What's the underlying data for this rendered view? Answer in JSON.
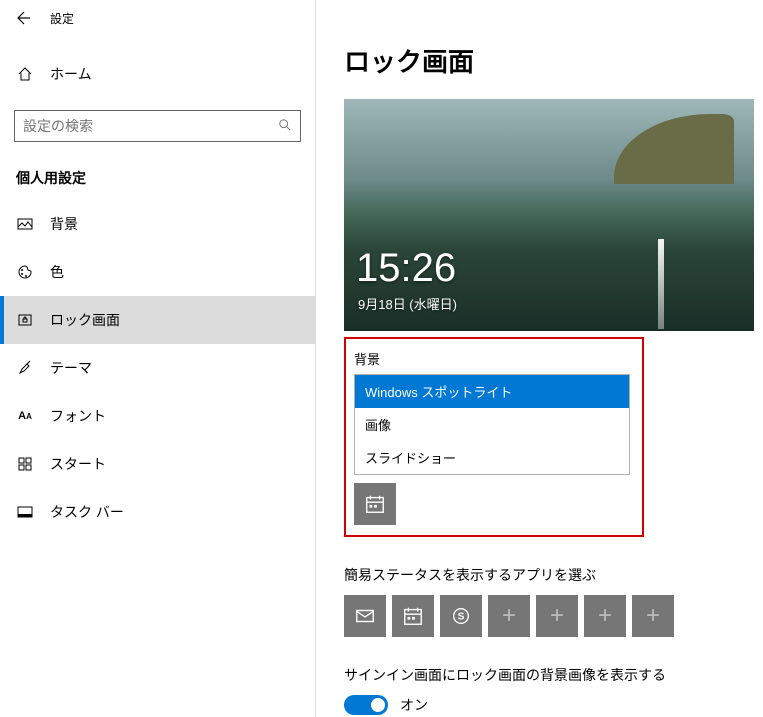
{
  "header": {
    "window_title": "設定"
  },
  "sidebar": {
    "home_label": "ホーム",
    "search_placeholder": "設定の検索",
    "section_heading": "個人用設定",
    "items": [
      {
        "label": "背景",
        "icon": "picture-icon"
      },
      {
        "label": "色",
        "icon": "palette-icon"
      },
      {
        "label": "ロック画面",
        "icon": "lock-frame-icon",
        "selected": true
      },
      {
        "label": "テーマ",
        "icon": "paintbrush-icon"
      },
      {
        "label": "フォント",
        "icon": "font-icon"
      },
      {
        "label": "スタート",
        "icon": "start-grid-icon"
      },
      {
        "label": "タスク バー",
        "icon": "taskbar-icon"
      }
    ]
  },
  "main": {
    "page_title": "ロック画面",
    "preview": {
      "time": "15:26",
      "date": "9月18日 (水曜日)"
    },
    "background": {
      "label": "背景",
      "options": [
        "Windows スポットライト",
        "画像",
        "スライドショー"
      ],
      "selected_index": 0
    },
    "brief_status": {
      "label": "簡易ステータスを表示するアプリを選ぶ",
      "tiles": [
        "mail",
        "calendar",
        "skype",
        "add",
        "add",
        "add",
        "add"
      ]
    },
    "signin_bg": {
      "label": "サインイン画面にロック画面の背景画像を表示する",
      "state": "オン",
      "on": true
    }
  }
}
